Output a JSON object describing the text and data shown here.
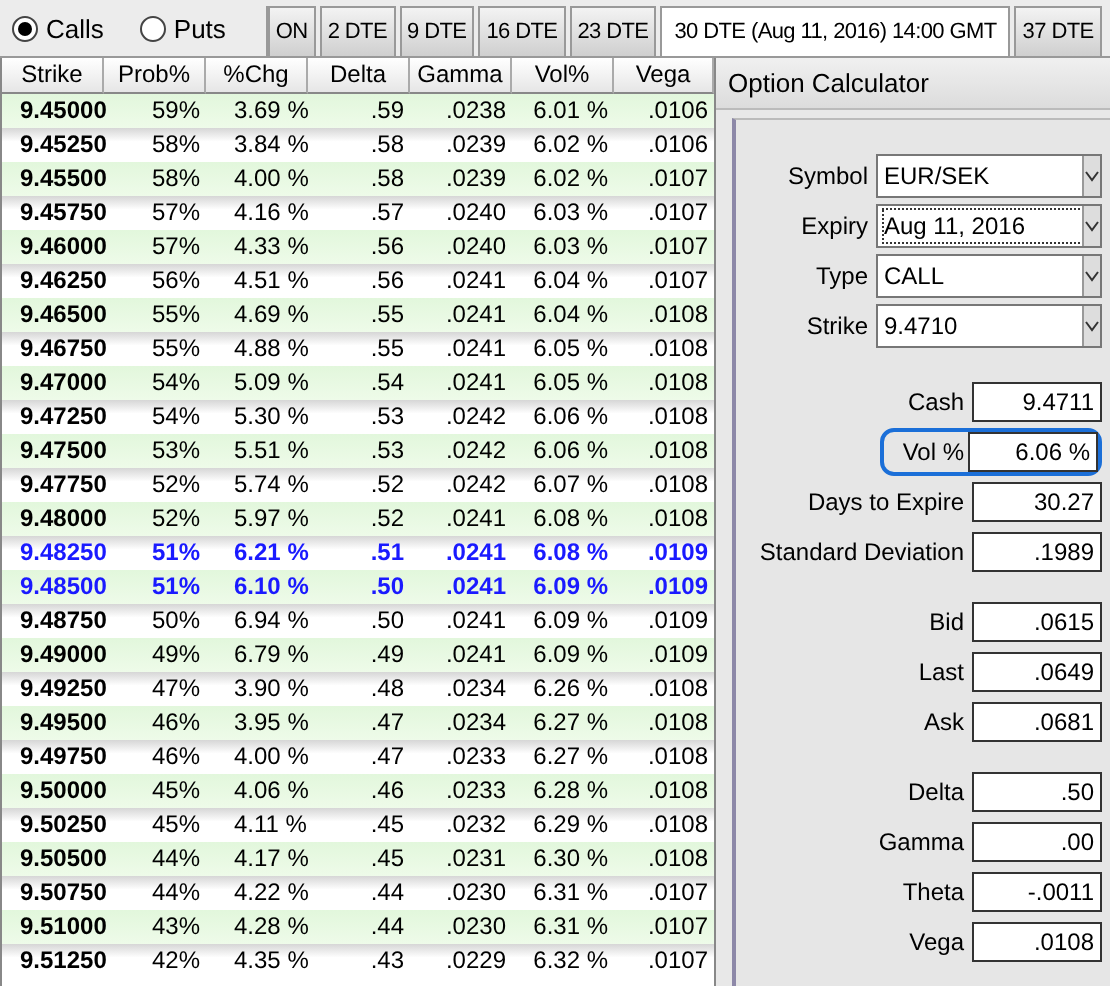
{
  "option_type": [
    {
      "label": "Calls",
      "selected": true
    },
    {
      "label": "Puts",
      "selected": false
    }
  ],
  "expiry_tabs": [
    {
      "label": "ON",
      "selected": false
    },
    {
      "label": "2 DTE",
      "selected": false
    },
    {
      "label": "9 DTE",
      "selected": false
    },
    {
      "label": "16 DTE",
      "selected": false
    },
    {
      "label": "23 DTE",
      "selected": false
    },
    {
      "label": "30 DTE (Aug 11, 2016) 14:00 GMT",
      "selected": true
    },
    {
      "label": "37 DTE",
      "selected": false
    }
  ],
  "table": {
    "columns": [
      "Strike",
      "Prob%",
      "%Chg",
      "Delta",
      "Gamma",
      "Vol%",
      "Vega"
    ],
    "rows": [
      {
        "cells": [
          "9.45000",
          "59%",
          "3.69 %",
          ".59",
          ".0238",
          "6.01 %",
          ".0106"
        ],
        "highlighted": false
      },
      {
        "cells": [
          "9.45250",
          "58%",
          "3.84 %",
          ".58",
          ".0239",
          "6.02 %",
          ".0106"
        ],
        "highlighted": false
      },
      {
        "cells": [
          "9.45500",
          "58%",
          "4.00 %",
          ".58",
          ".0239",
          "6.02 %",
          ".0107"
        ],
        "highlighted": false
      },
      {
        "cells": [
          "9.45750",
          "57%",
          "4.16 %",
          ".57",
          ".0240",
          "6.03 %",
          ".0107"
        ],
        "highlighted": false
      },
      {
        "cells": [
          "9.46000",
          "57%",
          "4.33 %",
          ".56",
          ".0240",
          "6.03 %",
          ".0107"
        ],
        "highlighted": false
      },
      {
        "cells": [
          "9.46250",
          "56%",
          "4.51 %",
          ".56",
          ".0241",
          "6.04 %",
          ".0107"
        ],
        "highlighted": false
      },
      {
        "cells": [
          "9.46500",
          "55%",
          "4.69 %",
          ".55",
          ".0241",
          "6.04 %",
          ".0108"
        ],
        "highlighted": false
      },
      {
        "cells": [
          "9.46750",
          "55%",
          "4.88 %",
          ".55",
          ".0241",
          "6.05 %",
          ".0108"
        ],
        "highlighted": false
      },
      {
        "cells": [
          "9.47000",
          "54%",
          "5.09 %",
          ".54",
          ".0241",
          "6.05 %",
          ".0108"
        ],
        "highlighted": false
      },
      {
        "cells": [
          "9.47250",
          "54%",
          "5.30 %",
          ".53",
          ".0242",
          "6.06 %",
          ".0108"
        ],
        "highlighted": false
      },
      {
        "cells": [
          "9.47500",
          "53%",
          "5.51 %",
          ".53",
          ".0242",
          "6.06 %",
          ".0108"
        ],
        "highlighted": false
      },
      {
        "cells": [
          "9.47750",
          "52%",
          "5.74 %",
          ".52",
          ".0242",
          "6.07 %",
          ".0108"
        ],
        "highlighted": false
      },
      {
        "cells": [
          "9.48000",
          "52%",
          "5.97 %",
          ".52",
          ".0241",
          "6.08 %",
          ".0108"
        ],
        "highlighted": false
      },
      {
        "cells": [
          "9.48250",
          "51%",
          "6.21 %",
          ".51",
          ".0241",
          "6.08 %",
          ".0109"
        ],
        "highlighted": true
      },
      {
        "cells": [
          "9.48500",
          "51%",
          "6.10 %",
          ".50",
          ".0241",
          "6.09 %",
          ".0109"
        ],
        "highlighted": true
      },
      {
        "cells": [
          "9.48750",
          "50%",
          "6.94 %",
          ".50",
          ".0241",
          "6.09 %",
          ".0109"
        ],
        "highlighted": false
      },
      {
        "cells": [
          "9.49000",
          "49%",
          "6.79 %",
          ".49",
          ".0241",
          "6.09 %",
          ".0109"
        ],
        "highlighted": false
      },
      {
        "cells": [
          "9.49250",
          "47%",
          "3.90 %",
          ".48",
          ".0234",
          "6.26 %",
          ".0108"
        ],
        "highlighted": false
      },
      {
        "cells": [
          "9.49500",
          "46%",
          "3.95 %",
          ".47",
          ".0234",
          "6.27 %",
          ".0108"
        ],
        "highlighted": false
      },
      {
        "cells": [
          "9.49750",
          "46%",
          "4.00 %",
          ".47",
          ".0233",
          "6.27 %",
          ".0108"
        ],
        "highlighted": false
      },
      {
        "cells": [
          "9.50000",
          "45%",
          "4.06 %",
          ".46",
          ".0233",
          "6.28 %",
          ".0108"
        ],
        "highlighted": false
      },
      {
        "cells": [
          "9.50250",
          "45%",
          "4.11 %",
          ".45",
          ".0232",
          "6.29 %",
          ".0108"
        ],
        "highlighted": false
      },
      {
        "cells": [
          "9.50500",
          "44%",
          "4.17 %",
          ".45",
          ".0231",
          "6.30 %",
          ".0108"
        ],
        "highlighted": false
      },
      {
        "cells": [
          "9.50750",
          "44%",
          "4.22 %",
          ".44",
          ".0230",
          "6.31 %",
          ".0107"
        ],
        "highlighted": false
      },
      {
        "cells": [
          "9.51000",
          "43%",
          "4.28 %",
          ".44",
          ".0230",
          "6.31 %",
          ".0107"
        ],
        "highlighted": false
      },
      {
        "cells": [
          "9.51250",
          "42%",
          "4.35 %",
          ".43",
          ".0229",
          "6.32 %",
          ".0107"
        ],
        "highlighted": false
      }
    ]
  },
  "calculator": {
    "title": "Option Calculator",
    "selects": [
      {
        "label": "Symbol",
        "value": "EUR/SEK",
        "focused": false
      },
      {
        "label": "Expiry",
        "value": "Aug 11, 2016",
        "focused": true
      },
      {
        "label": "Type",
        "value": "CALL",
        "focused": false
      },
      {
        "label": "Strike",
        "value": "9.4710",
        "focused": false
      }
    ],
    "groups": [
      [
        {
          "label": "Cash",
          "value": "9.4711",
          "highlighted": false
        },
        {
          "label": "Vol %",
          "value": "6.06 %",
          "highlighted": true
        },
        {
          "label": "Days to Expire",
          "value": "30.27",
          "highlighted": false
        },
        {
          "label": "Standard Deviation",
          "value": ".1989",
          "highlighted": false
        }
      ],
      [
        {
          "label": "Bid",
          "value": ".0615",
          "highlighted": false
        },
        {
          "label": "Last",
          "value": ".0649",
          "highlighted": false
        },
        {
          "label": "Ask",
          "value": ".0681",
          "highlighted": false
        }
      ],
      [
        {
          "label": "Delta",
          "value": ".50",
          "highlighted": false
        },
        {
          "label": "Gamma",
          "value": ".00",
          "highlighted": false
        },
        {
          "label": "Theta",
          "value": "-.0011",
          "highlighted": false
        },
        {
          "label": "Vega",
          "value": ".0108",
          "highlighted": false
        }
      ]
    ]
  }
}
